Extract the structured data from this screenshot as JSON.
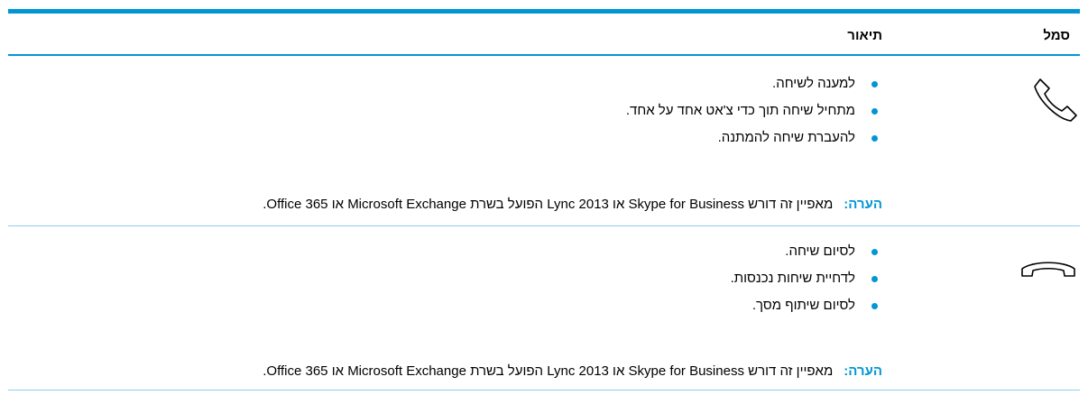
{
  "table": {
    "header": {
      "symbol": "סמל",
      "description": "תיאור"
    },
    "rows": [
      {
        "icon": "answer-call-icon",
        "bullets": [
          "למענה לשיחה.",
          "מתחיל שיחה תוך כדי צ'אט אחד על אחד.",
          "להעברת שיחה להמתנה."
        ],
        "note_label": "הערה:",
        "note_text": "מאפיין זה דורש Skype for Business או Lync 2013 הפועל בשרת Microsoft Exchange או Office 365."
      },
      {
        "icon": "end-call-icon",
        "bullets": [
          "לסיום שיחה.",
          "לדחיית שיחות נכנסות.",
          "לסיום שיתוף מסך."
        ],
        "note_label": "הערה:",
        "note_text": "מאפיין זה דורש Skype for Business או Lync 2013 הפועל בשרת Microsoft Exchange או Office 365."
      }
    ]
  },
  "colors": {
    "accent": "#0096d6",
    "divider": "#8ecfee"
  }
}
